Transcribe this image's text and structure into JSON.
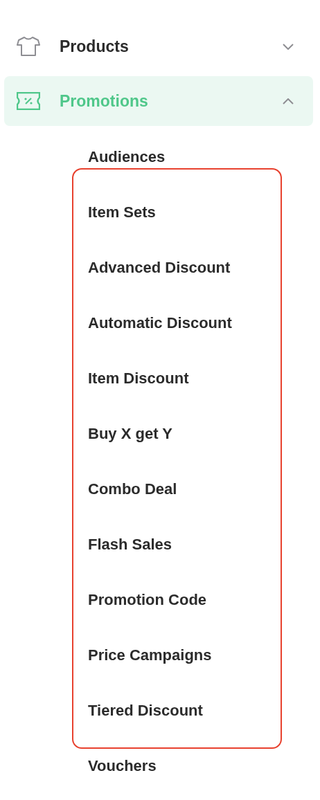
{
  "menu": [
    {
      "label": "Products",
      "selected": false,
      "expanded": false
    },
    {
      "label": "Promotions",
      "selected": true,
      "expanded": true,
      "children": [
        {
          "kind": "item",
          "label": "Audiences"
        },
        {
          "kind": "highlight-group",
          "children": [
            {
              "label": "Item Sets"
            },
            {
              "label": "Advanced Discount"
            },
            {
              "label": "Automatic Discount"
            },
            {
              "label": "Item Discount"
            },
            {
              "label": "Buy X get Y"
            },
            {
              "label": "Combo Deal"
            },
            {
              "label": "Flash Sales"
            },
            {
              "label": "Promotion Code"
            },
            {
              "label": "Price Campaigns"
            },
            {
              "label": "Tiered Discount"
            }
          ]
        },
        {
          "kind": "item",
          "label": "Vouchers"
        }
      ]
    }
  ]
}
